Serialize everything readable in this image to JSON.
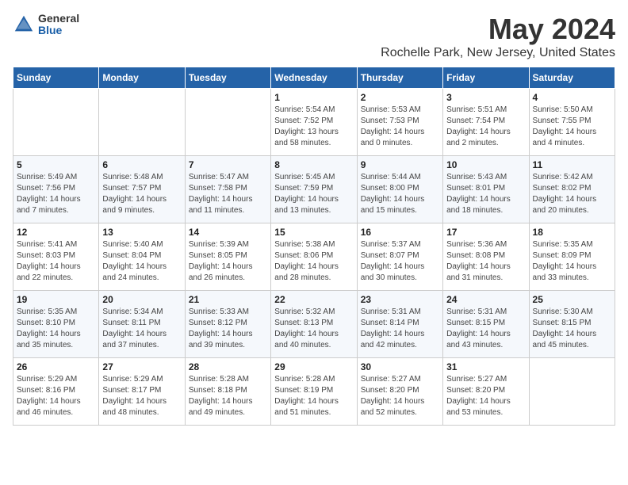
{
  "logo": {
    "general": "General",
    "blue": "Blue"
  },
  "title": "May 2024",
  "location": "Rochelle Park, New Jersey, United States",
  "days_of_week": [
    "Sunday",
    "Monday",
    "Tuesday",
    "Wednesday",
    "Thursday",
    "Friday",
    "Saturday"
  ],
  "weeks": [
    {
      "days": [
        {
          "number": "",
          "content": ""
        },
        {
          "number": "",
          "content": ""
        },
        {
          "number": "",
          "content": ""
        },
        {
          "number": "1",
          "content": "Sunrise: 5:54 AM\nSunset: 7:52 PM\nDaylight: 13 hours and 58 minutes."
        },
        {
          "number": "2",
          "content": "Sunrise: 5:53 AM\nSunset: 7:53 PM\nDaylight: 14 hours and 0 minutes."
        },
        {
          "number": "3",
          "content": "Sunrise: 5:51 AM\nSunset: 7:54 PM\nDaylight: 14 hours and 2 minutes."
        },
        {
          "number": "4",
          "content": "Sunrise: 5:50 AM\nSunset: 7:55 PM\nDaylight: 14 hours and 4 minutes."
        }
      ]
    },
    {
      "days": [
        {
          "number": "5",
          "content": "Sunrise: 5:49 AM\nSunset: 7:56 PM\nDaylight: 14 hours and 7 minutes."
        },
        {
          "number": "6",
          "content": "Sunrise: 5:48 AM\nSunset: 7:57 PM\nDaylight: 14 hours and 9 minutes."
        },
        {
          "number": "7",
          "content": "Sunrise: 5:47 AM\nSunset: 7:58 PM\nDaylight: 14 hours and 11 minutes."
        },
        {
          "number": "8",
          "content": "Sunrise: 5:45 AM\nSunset: 7:59 PM\nDaylight: 14 hours and 13 minutes."
        },
        {
          "number": "9",
          "content": "Sunrise: 5:44 AM\nSunset: 8:00 PM\nDaylight: 14 hours and 15 minutes."
        },
        {
          "number": "10",
          "content": "Sunrise: 5:43 AM\nSunset: 8:01 PM\nDaylight: 14 hours and 18 minutes."
        },
        {
          "number": "11",
          "content": "Sunrise: 5:42 AM\nSunset: 8:02 PM\nDaylight: 14 hours and 20 minutes."
        }
      ]
    },
    {
      "days": [
        {
          "number": "12",
          "content": "Sunrise: 5:41 AM\nSunset: 8:03 PM\nDaylight: 14 hours and 22 minutes."
        },
        {
          "number": "13",
          "content": "Sunrise: 5:40 AM\nSunset: 8:04 PM\nDaylight: 14 hours and 24 minutes."
        },
        {
          "number": "14",
          "content": "Sunrise: 5:39 AM\nSunset: 8:05 PM\nDaylight: 14 hours and 26 minutes."
        },
        {
          "number": "15",
          "content": "Sunrise: 5:38 AM\nSunset: 8:06 PM\nDaylight: 14 hours and 28 minutes."
        },
        {
          "number": "16",
          "content": "Sunrise: 5:37 AM\nSunset: 8:07 PM\nDaylight: 14 hours and 30 minutes."
        },
        {
          "number": "17",
          "content": "Sunrise: 5:36 AM\nSunset: 8:08 PM\nDaylight: 14 hours and 31 minutes."
        },
        {
          "number": "18",
          "content": "Sunrise: 5:35 AM\nSunset: 8:09 PM\nDaylight: 14 hours and 33 minutes."
        }
      ]
    },
    {
      "days": [
        {
          "number": "19",
          "content": "Sunrise: 5:35 AM\nSunset: 8:10 PM\nDaylight: 14 hours and 35 minutes."
        },
        {
          "number": "20",
          "content": "Sunrise: 5:34 AM\nSunset: 8:11 PM\nDaylight: 14 hours and 37 minutes."
        },
        {
          "number": "21",
          "content": "Sunrise: 5:33 AM\nSunset: 8:12 PM\nDaylight: 14 hours and 39 minutes."
        },
        {
          "number": "22",
          "content": "Sunrise: 5:32 AM\nSunset: 8:13 PM\nDaylight: 14 hours and 40 minutes."
        },
        {
          "number": "23",
          "content": "Sunrise: 5:31 AM\nSunset: 8:14 PM\nDaylight: 14 hours and 42 minutes."
        },
        {
          "number": "24",
          "content": "Sunrise: 5:31 AM\nSunset: 8:15 PM\nDaylight: 14 hours and 43 minutes."
        },
        {
          "number": "25",
          "content": "Sunrise: 5:30 AM\nSunset: 8:15 PM\nDaylight: 14 hours and 45 minutes."
        }
      ]
    },
    {
      "days": [
        {
          "number": "26",
          "content": "Sunrise: 5:29 AM\nSunset: 8:16 PM\nDaylight: 14 hours and 46 minutes."
        },
        {
          "number": "27",
          "content": "Sunrise: 5:29 AM\nSunset: 8:17 PM\nDaylight: 14 hours and 48 minutes."
        },
        {
          "number": "28",
          "content": "Sunrise: 5:28 AM\nSunset: 8:18 PM\nDaylight: 14 hours and 49 minutes."
        },
        {
          "number": "29",
          "content": "Sunrise: 5:28 AM\nSunset: 8:19 PM\nDaylight: 14 hours and 51 minutes."
        },
        {
          "number": "30",
          "content": "Sunrise: 5:27 AM\nSunset: 8:20 PM\nDaylight: 14 hours and 52 minutes."
        },
        {
          "number": "31",
          "content": "Sunrise: 5:27 AM\nSunset: 8:20 PM\nDaylight: 14 hours and 53 minutes."
        },
        {
          "number": "",
          "content": ""
        }
      ]
    }
  ]
}
